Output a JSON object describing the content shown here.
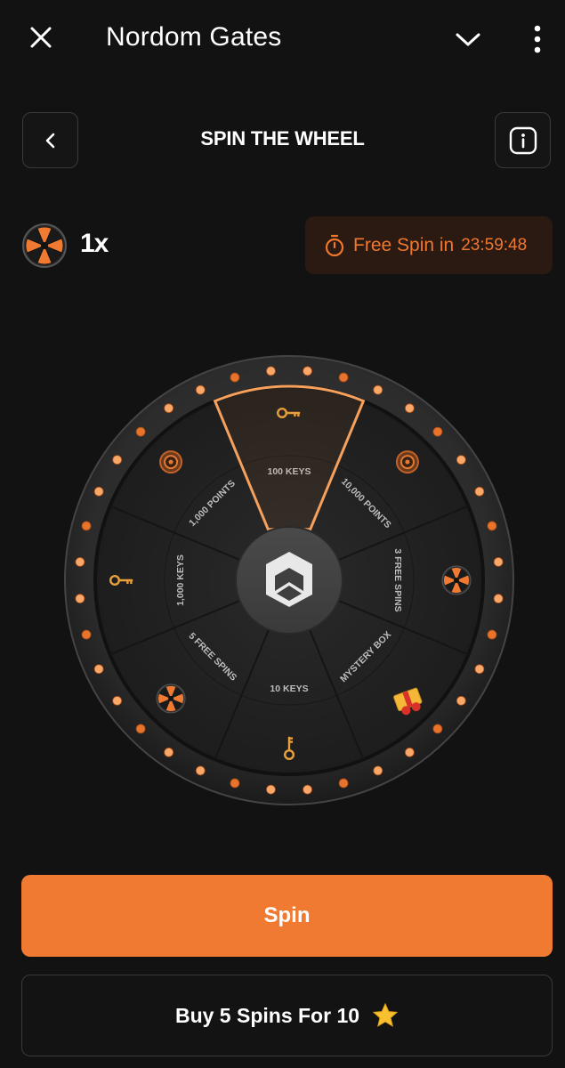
{
  "topbar": {
    "title": "Nordom Gates",
    "close_icon": "close-icon",
    "chevron_icon": "chevron-down-icon",
    "more_icon": "more-vertical-icon"
  },
  "header": {
    "title": "SPIN THE WHEEL",
    "back_icon": "chevron-left-icon",
    "info_icon": "info-icon"
  },
  "spins": {
    "count": "1x",
    "icon": "wheel-icon"
  },
  "timer": {
    "label": "Free Spin in",
    "value": "23:59:48",
    "icon": "stopwatch-icon"
  },
  "wheel": {
    "center_icon": "brand-logo-icon",
    "segments": [
      {
        "label": "100 KEYS",
        "icon": "key-icon"
      },
      {
        "label": "10,000 POINTS",
        "icon": "coin-icon"
      },
      {
        "label": "3 FREE SPINS",
        "icon": "wheel-icon"
      },
      {
        "label": "MYSTERY BOX",
        "icon": "gift-box-icon"
      },
      {
        "label": "10 KEYS",
        "icon": "key-icon"
      },
      {
        "label": "5 FREE SPINS",
        "icon": "wheel-icon"
      },
      {
        "label": "1,000 KEYS",
        "icon": "key-icon"
      },
      {
        "label": "1,000 POINTS",
        "icon": "coin-icon"
      }
    ],
    "highlighted_segment": "100 KEYS"
  },
  "actions": {
    "spin_label": "Spin",
    "buy_label": "Buy 5 Spins For 10",
    "buy_icon": "star-icon"
  },
  "colors": {
    "accent": "#f07a31",
    "background": "#121212",
    "timer_bg": "#2b1a11"
  }
}
